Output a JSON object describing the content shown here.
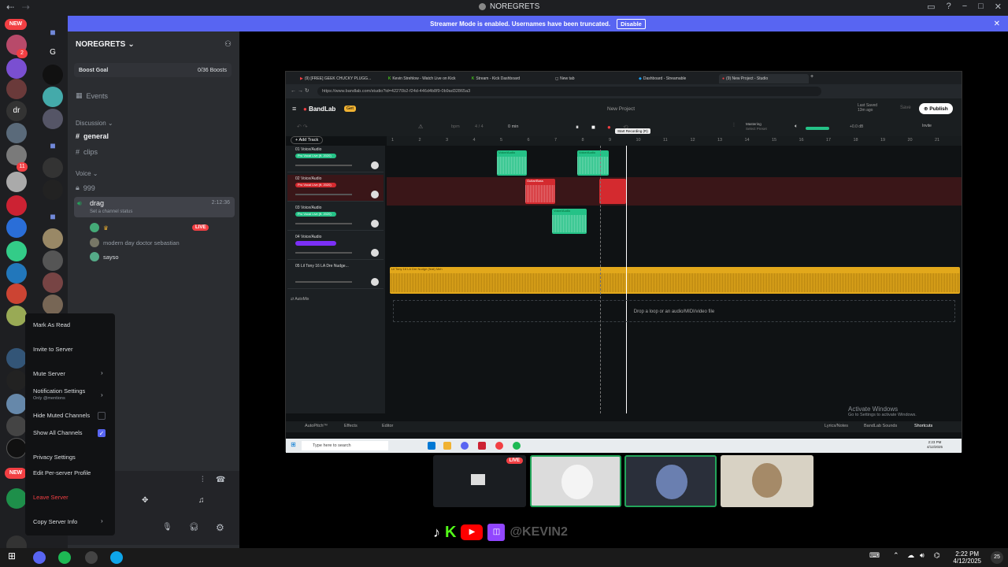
{
  "window": {
    "title": "NOREGRETS",
    "back_icon": "back-arrow-icon",
    "forward_icon": "forward-arrow-icon"
  },
  "banner": {
    "text": "Streamer Mode is enabled. Usernames have been truncated.",
    "disable_label": "Disable",
    "color": "#5865f2"
  },
  "server": {
    "name": "NOREGRETS",
    "boost_goal_label": "Boost Goal",
    "boost_count": "0/36 Boosts",
    "events_label": "Events",
    "discussion_label": "Discussion",
    "channels": [
      {
        "name": "general",
        "icon": "hash-icon"
      },
      {
        "name": "clips",
        "icon": "hash-icon"
      }
    ],
    "voice_label": "Voice",
    "voice_channels": [
      {
        "name": "999",
        "icon": "lock-icon"
      },
      {
        "name": "drag",
        "icon": "speaker-icon",
        "timer": "2:12:36",
        "status": "Set a channel status"
      }
    ],
    "members": [
      {
        "name": "",
        "live": "LIVE"
      },
      {
        "name": "modern day doctor sebastian"
      },
      {
        "name": "sayso"
      }
    ]
  },
  "rail": {
    "new_label": "NEW",
    "badges": [
      "2",
      "33",
      "11",
      "2",
      "2",
      "11",
      "2"
    ],
    "letters": [
      "G",
      "dr"
    ]
  },
  "context_menu": {
    "items": [
      {
        "label": "Mark As Read"
      },
      {
        "label": "Invite to Server"
      },
      {
        "label": "Mute Server",
        "submenu": true
      },
      {
        "label": "Notification Settings",
        "sub": "Only @mentions",
        "submenu": true
      },
      {
        "label": "Hide Muted Channels",
        "checkbox": false
      },
      {
        "label": "Show All Channels",
        "checkbox": true
      },
      {
        "label": "Privacy Settings"
      },
      {
        "label": "Edit Per-server Profile"
      },
      {
        "label": "Leave Server",
        "danger": true
      },
      {
        "label": "Copy Server Info",
        "submenu": true
      }
    ]
  },
  "browser": {
    "tabs": [
      "(9) [FREE] GEEK CHUCKY PLUGG...",
      "Kevin Strehlow - Watch Live on Kick",
      "Stream - Kick Dashboard",
      "New tab",
      "Dashboard - Streamable",
      "(9) New Project - Studio"
    ],
    "url": "https://www.bandlab.com/studio?id=42270b2-f24d-446d4b8f9-0b9ad32865a3",
    "new_tab_label": "+"
  },
  "bandlab": {
    "logo": "BandLab",
    "badge": "Get",
    "project_title": "New Project",
    "last_saved": "Last Saved",
    "last_saved_time": "13m ago",
    "save_label": "Save",
    "publish_label": "Publish",
    "invite_label": "Invite",
    "bpm_label": "bpm",
    "time_sig": "4 / 4",
    "time_display": "0 min",
    "mastering_label": "Mastering",
    "mastering_sub": "Select Preset",
    "volume_db": "+0.0 dB",
    "tooltip": "Start Recording (R)",
    "add_track_label": "Add Track",
    "ruler": [
      "1",
      "2",
      "3",
      "4",
      "5",
      "6",
      "7",
      "8",
      "9",
      "10",
      "11",
      "12",
      "13",
      "14",
      "15",
      "16",
      "17",
      "18",
      "19",
      "20",
      "21"
    ],
    "tracks": [
      {
        "name": "01 Voice/Audio",
        "fx": "Pro Vocal Live (ft. 2020)",
        "pill_color": "#25c287"
      },
      {
        "name": "02 Voice/Audio",
        "fx": "Pro Vocal Live (ft. 2020)",
        "pill_color": "#d42a2f"
      },
      {
        "name": "03 Voice/Audio",
        "fx": "Pro Vocal Live (ft. 2020)",
        "pill_color": "#25c287"
      },
      {
        "name": "04 Voice/Audio",
        "fx": "",
        "pill_color": "#7b2ff7"
      },
      {
        "name": "05 Lil Tony 16 LA Dre Nudge...",
        "fx": "",
        "pill_color": "#e2a81b"
      }
    ],
    "clip_labels": [
      "Voice/Audio",
      "Voice/Audio",
      "Guitar/Bass",
      "Voice/Audio",
      "Lil Tony 16 LA Dre Nudge (feat) Meh"
    ],
    "automix_label": "AutoMix",
    "dropzone_text": "Drop a loop or an audio/MIDI/video file",
    "bottom_left": [
      "AutoPitch™",
      "Effects",
      "Editor"
    ],
    "bottom_right": [
      "Lyrics/Notes",
      "BandLab Sounds",
      "Shortcuts"
    ],
    "activate_title": "Activate Windows",
    "activate_sub": "Go to Settings to activate Windows.",
    "taskbar_search": "Type here to search",
    "inner_clock_time": "2:23 PM",
    "inner_clock_date": "4/12/2025"
  },
  "stream": {
    "live_label": "LIVE",
    "social_handle": "@KEVIN2"
  },
  "taskbar": {
    "time": "2:22 PM",
    "date": "4/12/2025",
    "notif_count": "25"
  }
}
